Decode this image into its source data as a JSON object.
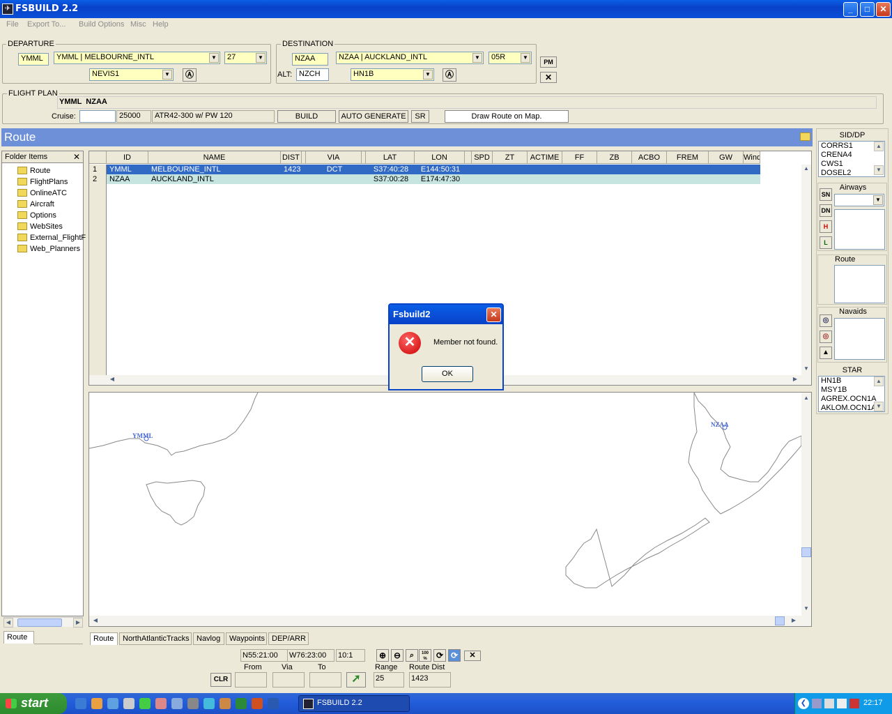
{
  "window": {
    "title": "FSBUILD 2.2",
    "minimize": "_",
    "maximize": "□",
    "close": "✕"
  },
  "menu": [
    "File",
    "Export To...",
    "Build Options",
    "Misc",
    "Help"
  ],
  "departure": {
    "group_label": "DEPARTURE",
    "icao": "YMML",
    "airport": "YMML | MELBOURNE_INTL",
    "runway": "27",
    "sid": "NEVIS1"
  },
  "destination": {
    "group_label": "DESTINATION",
    "icao": "NZAA",
    "airport": "NZAA | AUCKLAND_INTL",
    "runway": "05R",
    "alt_label": "ALT:",
    "alt_value": "NZCH",
    "star": "HN1B"
  },
  "side_buttons": {
    "pm": "PM"
  },
  "flight_plan": {
    "group_label": "FLIGHT PLAN",
    "route_text": "YMML  NZAA",
    "cruise_label": "Cruise:",
    "cruise_value": "",
    "altitude": "25000",
    "aircraft": "ATR42-300 w/ PW 120",
    "build_label": "BUILD",
    "auto_generate_label": "AUTO GENERATE",
    "sr_label": "SR",
    "draw_route_label": "Draw Route on Map."
  },
  "route_header": {
    "title": "Route"
  },
  "folder_panel": {
    "header": "Folder Items",
    "items": [
      "Route",
      "FlightPlans",
      "OnlineATC",
      "Aircraft",
      "Options",
      "WebSites",
      "External_FlightF",
      "Web_Planners"
    ],
    "bottom_tab": "Route"
  },
  "grid": {
    "columns": [
      "ID",
      "NAME",
      "DIST",
      "VIA",
      "LAT",
      "LON",
      "SPD",
      "ZT",
      "ACTIME",
      "FF",
      "ZB",
      "ACBO",
      "FREM",
      "GW",
      "Wind"
    ],
    "rows": [
      {
        "num": "1",
        "id": "YMML",
        "name": "MELBOURNE_INTL",
        "dist": "1423",
        "via": "DCT",
        "lat": "S37:40:28",
        "lon": "E144:50:31"
      },
      {
        "num": "2",
        "id": "NZAA",
        "name": "AUCKLAND_INTL",
        "dist": "",
        "via": "",
        "lat": "S37:00:28",
        "lon": "E174:47:30"
      }
    ]
  },
  "map": {
    "labels": [
      "YMML",
      "NZAA"
    ]
  },
  "bottom_tabs": [
    "Route",
    "NorthAtlanticTracks",
    "Navlog",
    "Waypoints",
    "DEP/ARR"
  ],
  "status": {
    "lat": "N55:21:00",
    "lon": "W76:23:00",
    "scale": "10:1",
    "from_label": "From",
    "via_label": "Via",
    "to_label": "To",
    "clr_label": "CLR",
    "range_label": "Range",
    "range_value": "25",
    "route_dist_label": "Route Dist",
    "route_dist_value": "1423",
    "zoom_100": "100 %"
  },
  "right_panel": {
    "sid_label": "SID/DP",
    "sid_items": [
      "CORRS1",
      "CRENA4",
      "CWS1",
      "DOSEL2"
    ],
    "airways_label": "Airways",
    "sn": "SN",
    "dn": "DN",
    "h": "H",
    "l": "L",
    "route_label": "Route",
    "navaids_label": "Navaids",
    "star_label": "STAR",
    "star_items": [
      "HN1B",
      "MSY1B",
      "AGREX.OCN1A",
      "AKLOM.OCN1A"
    ]
  },
  "dialog": {
    "title": "Fsbuild2",
    "message": "Member not found.",
    "ok_label": "OK"
  },
  "taskbar": {
    "start_label": "start",
    "task_label": "FSBUILD 2.2",
    "clock": "22:17"
  }
}
